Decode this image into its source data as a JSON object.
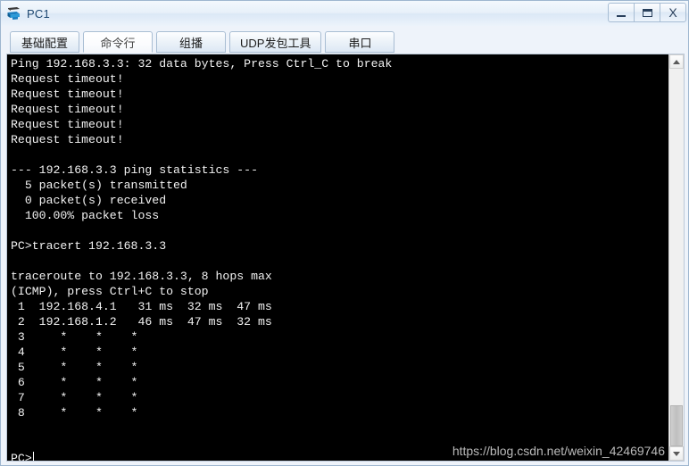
{
  "window": {
    "title": "PC1",
    "icon": "pc-device-icon",
    "controls": {
      "minimize_label": "_",
      "maximize_label": "□",
      "close_label": "X"
    }
  },
  "tabs": [
    {
      "id": "basic-config",
      "label": "基础配置",
      "active": false
    },
    {
      "id": "command-line",
      "label": "命令行",
      "active": true
    },
    {
      "id": "multicast",
      "label": "组播",
      "active": false
    },
    {
      "id": "udp-tool",
      "label": "UDP发包工具",
      "active": false
    },
    {
      "id": "serial-port",
      "label": "串口",
      "active": false
    }
  ],
  "console": {
    "lines": [
      "Ping 192.168.3.3: 32 data bytes, Press Ctrl_C to break",
      "Request timeout!",
      "Request timeout!",
      "Request timeout!",
      "Request timeout!",
      "Request timeout!",
      "",
      "--- 192.168.3.3 ping statistics ---",
      "  5 packet(s) transmitted",
      "  0 packet(s) received",
      "  100.00% packet loss",
      "",
      "PC>tracert 192.168.3.3",
      "",
      "traceroute to 192.168.3.3, 8 hops max",
      "(ICMP), press Ctrl+C to stop",
      " 1  192.168.4.1   31 ms  32 ms  47 ms",
      " 2  192.168.1.2   46 ms  47 ms  32 ms",
      " 3     *    *    *",
      " 4     *    *    *",
      " 5     *    *    *",
      " 6     *    *    *",
      " 7     *    *    *",
      " 8     *    *    *",
      "",
      ""
    ],
    "prompt": "PC>"
  },
  "scrollbar": {
    "up_arrow": "chevron-up-icon",
    "down_arrow": "chevron-down-icon"
  },
  "watermark": {
    "text": "https://blog.csdn.net/weixin_42469746"
  },
  "colors": {
    "console_bg": "#000000",
    "console_fg": "#f2f2f2",
    "title_text": "#1c4670",
    "chrome_bg": "#eef3fa"
  }
}
